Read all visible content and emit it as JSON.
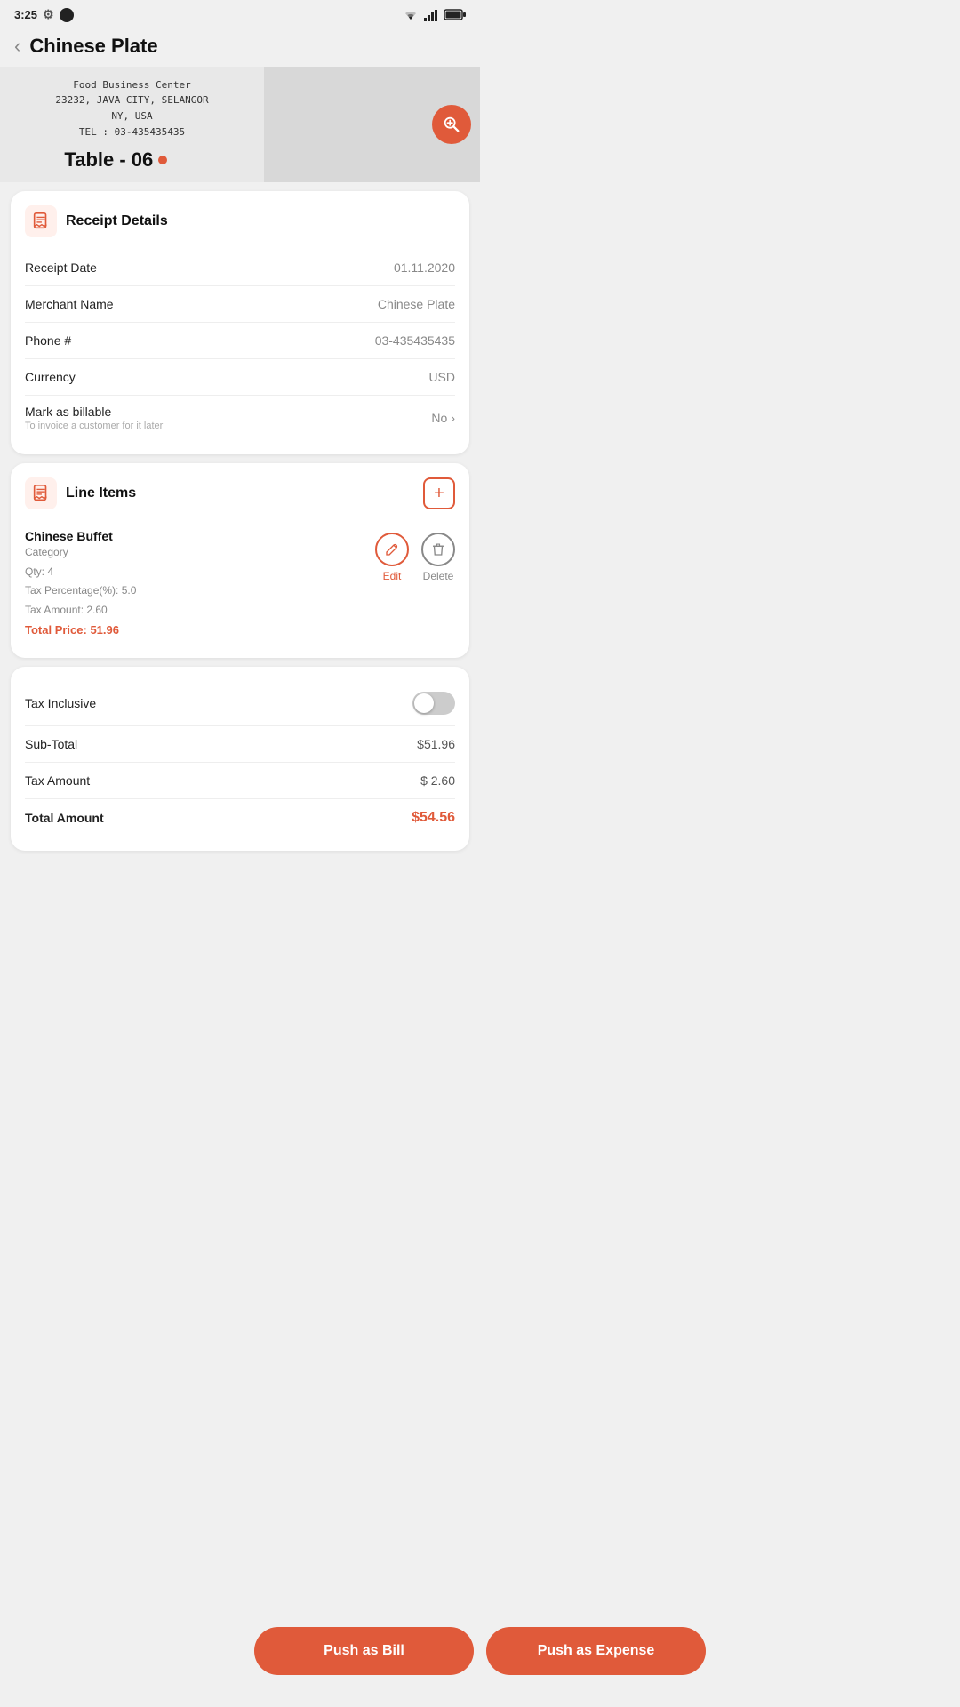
{
  "statusBar": {
    "time": "3:25",
    "batteryFull": true
  },
  "header": {
    "title": "Chinese Plate",
    "backLabel": "‹"
  },
  "receiptImage": {
    "businessName": "Food Business Center",
    "address": "23232, JAVA CITY, SELANGOR",
    "country": "NY, USA",
    "tel": "TEL : 03-435435435",
    "tableLabel": "Table - 06"
  },
  "receiptDetails": {
    "sectionTitle": "Receipt Details",
    "rows": [
      {
        "label": "Receipt Date",
        "value": "01.11.2020"
      },
      {
        "label": "Merchant Name",
        "value": "Chinese Plate"
      },
      {
        "label": "Phone #",
        "value": "03-435435435"
      },
      {
        "label": "Currency",
        "value": "USD"
      }
    ],
    "billable": {
      "label": "Mark as billable",
      "sub": "To invoice a customer for it later",
      "value": "No"
    }
  },
  "lineItems": {
    "sectionTitle": "Line Items",
    "addLabel": "+",
    "items": [
      {
        "name": "Chinese Buffet",
        "category": "Category",
        "qty": "Qty: 4",
        "taxPct": "Tax Percentage(%): 5.0",
        "taxAmt": "Tax Amount: 2.60",
        "total": "Total Price: 51.96"
      }
    ],
    "editLabel": "Edit",
    "deleteLabel": "Delete"
  },
  "summary": {
    "taxInclusiveLabel": "Tax Inclusive",
    "subtotalLabel": "Sub-Total",
    "subtotalValue": "$51.96",
    "taxAmountLabel": "Tax Amount",
    "taxAmountValue": "$ 2.60",
    "totalLabel": "Total Amount",
    "totalValue": "$54.56"
  },
  "buttons": {
    "pushBill": "Push as Bill",
    "pushExpense": "Push as Expense"
  }
}
